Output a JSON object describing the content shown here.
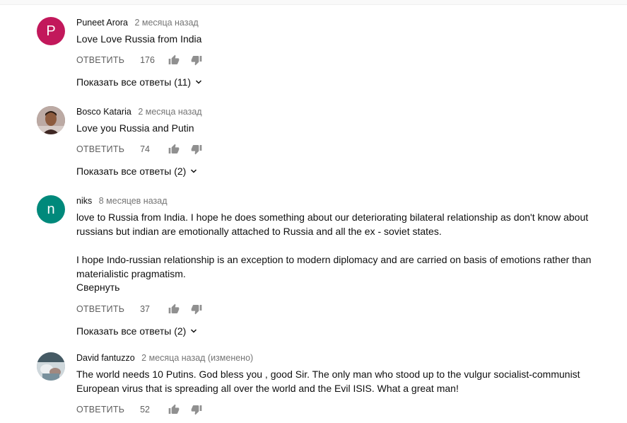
{
  "comments": [
    {
      "author": "Puneet Arora",
      "time": "2 месяца назад",
      "avatar_letter": "P",
      "avatar_color": "#c2185b",
      "lines": [
        "Love Love Russia from India"
      ],
      "reply_label": "ОТВЕТИТЬ",
      "likes": "176",
      "replies_label": "Показать все ответы (11)"
    },
    {
      "author": "Bosco Kataria",
      "time": "2 месяца назад",
      "avatar_letter": "",
      "avatar_color": "#8d6e63",
      "lines": [
        "Love you Russia and Putin"
      ],
      "reply_label": "ОТВЕТИТЬ",
      "likes": "74",
      "replies_label": "Показать все ответы (2)"
    },
    {
      "author": "niks",
      "time": "8 месяцев назад",
      "avatar_letter": "n",
      "avatar_color": "#00897b",
      "lines": [
        "love to Russia from India. I hope he does something about our deteriorating bilateral relationship as don't know about",
        "russians but indian are emotionally attached to Russia and all the ex - soviet states.",
        "",
        "I hope Indo-russian relationship is an exception to modern diplomacy and are carried on basis of emotions rather than",
        "materialistic pragmatism."
      ],
      "collapse_label": "Свернуть",
      "reply_label": "ОТВЕТИТЬ",
      "likes": "37",
      "replies_label": "Показать все ответы (2)"
    },
    {
      "author": "David fantuzzo",
      "time": "2 месяца назад (изменено)",
      "avatar_letter": "",
      "avatar_color": "#90a4ae",
      "lines": [
        "The world needs 10 Putins. God bless you , good Sir. The only man who stood up to the vulgur socialist-communist",
        "European virus that is spreading all over the world and the Evil ISIS. What a great man!"
      ],
      "reply_label": "ОТВЕТИТЬ",
      "likes": "52"
    }
  ],
  "icons": {
    "like": "thumb-up-icon",
    "dislike": "thumb-down-icon",
    "expand": "chevron-down-icon"
  },
  "colors": {
    "text": "#0f0f0f",
    "secondary": "#606060",
    "timestamp": "#757575"
  }
}
